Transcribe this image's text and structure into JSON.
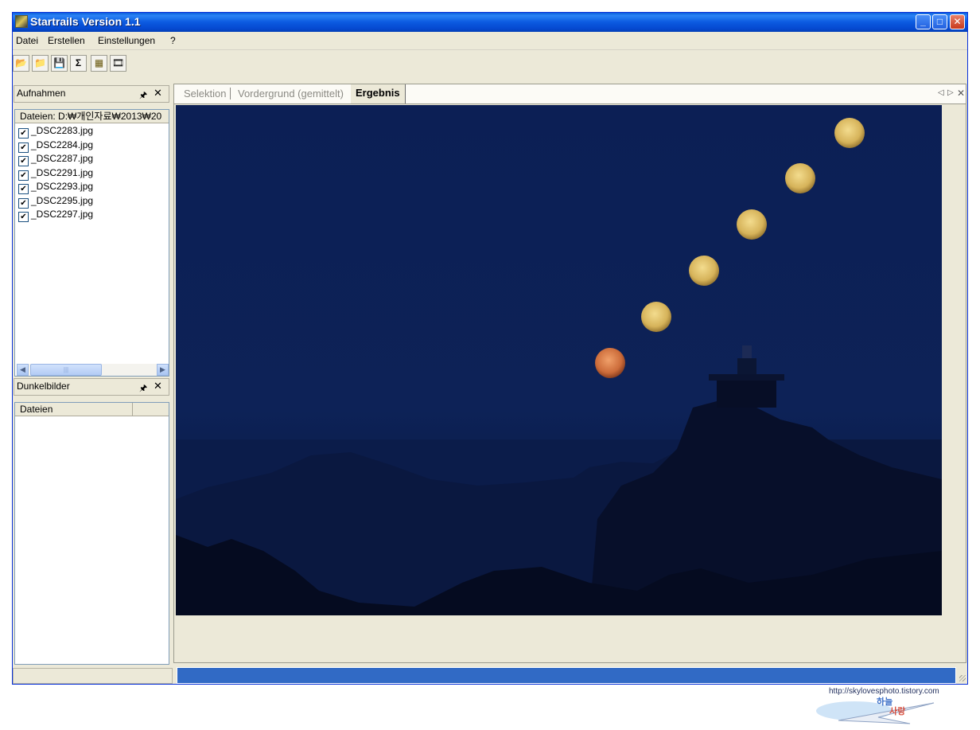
{
  "window": {
    "title": "Startrails Version 1.1"
  },
  "titlebar_buttons": {
    "minimize": "_",
    "maximize": "□",
    "close": "✕"
  },
  "menu": [
    "Datei",
    "Erstellen",
    "Einstellungen",
    "?"
  ],
  "toolbar": {
    "items": [
      {
        "icon": "open-folder-icon",
        "glyph": "📂"
      },
      {
        "icon": "open-file-icon",
        "glyph": "📁"
      },
      {
        "icon": "save-icon",
        "glyph": "💾"
      },
      {
        "icon": "sum-icon",
        "glyph": "Σ"
      },
      {
        "icon": "startrails-icon",
        "glyph": "▦"
      },
      {
        "icon": "video-icon",
        "glyph": "🎞"
      }
    ]
  },
  "aufnahmen_panel": {
    "title": "Aufnahmen",
    "pin": "🖈",
    "close": "✕",
    "header": "Dateien: D:₩개인자료₩2013₩20",
    "files": [
      {
        "name": "_DSC2283.jpg",
        "checked": true
      },
      {
        "name": "_DSC2284.jpg",
        "checked": true
      },
      {
        "name": "_DSC2287.jpg",
        "checked": true
      },
      {
        "name": "_DSC2291.jpg",
        "checked": true
      },
      {
        "name": "_DSC2293.jpg",
        "checked": true
      },
      {
        "name": "_DSC2295.jpg",
        "checked": true
      },
      {
        "name": "_DSC2297.jpg",
        "checked": true
      }
    ],
    "check_glyph": "✔",
    "scroll_left": "◀",
    "scroll_right": "▶",
    "scroll_grip": "|||"
  },
  "dunkelbilder_panel": {
    "title": "Dunkelbilder",
    "pin": "🖈",
    "close": "✕",
    "header": "Dateien"
  },
  "tabs": [
    {
      "label": "Selektion",
      "active": false
    },
    {
      "label": "Vordergrund (gemittelt)",
      "active": false
    },
    {
      "label": "Ergebnis",
      "active": true
    }
  ],
  "tab_nav": {
    "prev": "◁",
    "next": "▷",
    "close": "✕"
  },
  "result_image": {
    "description_icon": "moon-sequence-image",
    "moons": 6
  },
  "status": {
    "progress": 1.0
  },
  "watermark": {
    "url": "http://skylovesphoto.tistory.com",
    "line1": "하늘",
    "line2": "사랑"
  },
  "colors": {
    "titlebar": "#0a5fdc",
    "face": "#ece9d8",
    "progress": "#316ac5",
    "sky": "#0c1f55"
  }
}
